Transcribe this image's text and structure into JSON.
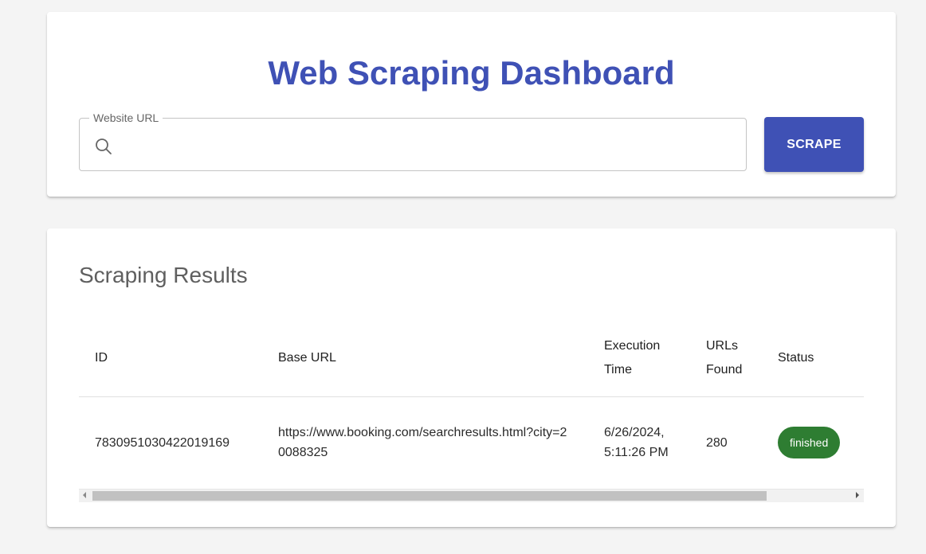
{
  "header": {
    "title": "Web Scraping Dashboard"
  },
  "search": {
    "label": "Website URL",
    "value": "",
    "placeholder": "",
    "icon": "search-icon"
  },
  "scrape_button": {
    "label": "SCRAPE"
  },
  "results": {
    "title": "Scraping Results",
    "columns": [
      "ID",
      "Base URL",
      "Execution Time",
      "URLs Found",
      "Status"
    ],
    "rows": [
      {
        "id": "7830951030422019169",
        "base_url": "https://www.booking.com/searchresults.html?city=20088325",
        "execution_time": "6/26/2024, 5:11:26 PM",
        "urls_found": "280",
        "status": "finished"
      }
    ]
  },
  "colors": {
    "primary": "#3f51b5",
    "status_finished": "#2e7d32",
    "background": "#f4f4f4"
  },
  "scrollbar": {
    "horizontal_position": 0.0,
    "visible_fraction": 0.86
  }
}
